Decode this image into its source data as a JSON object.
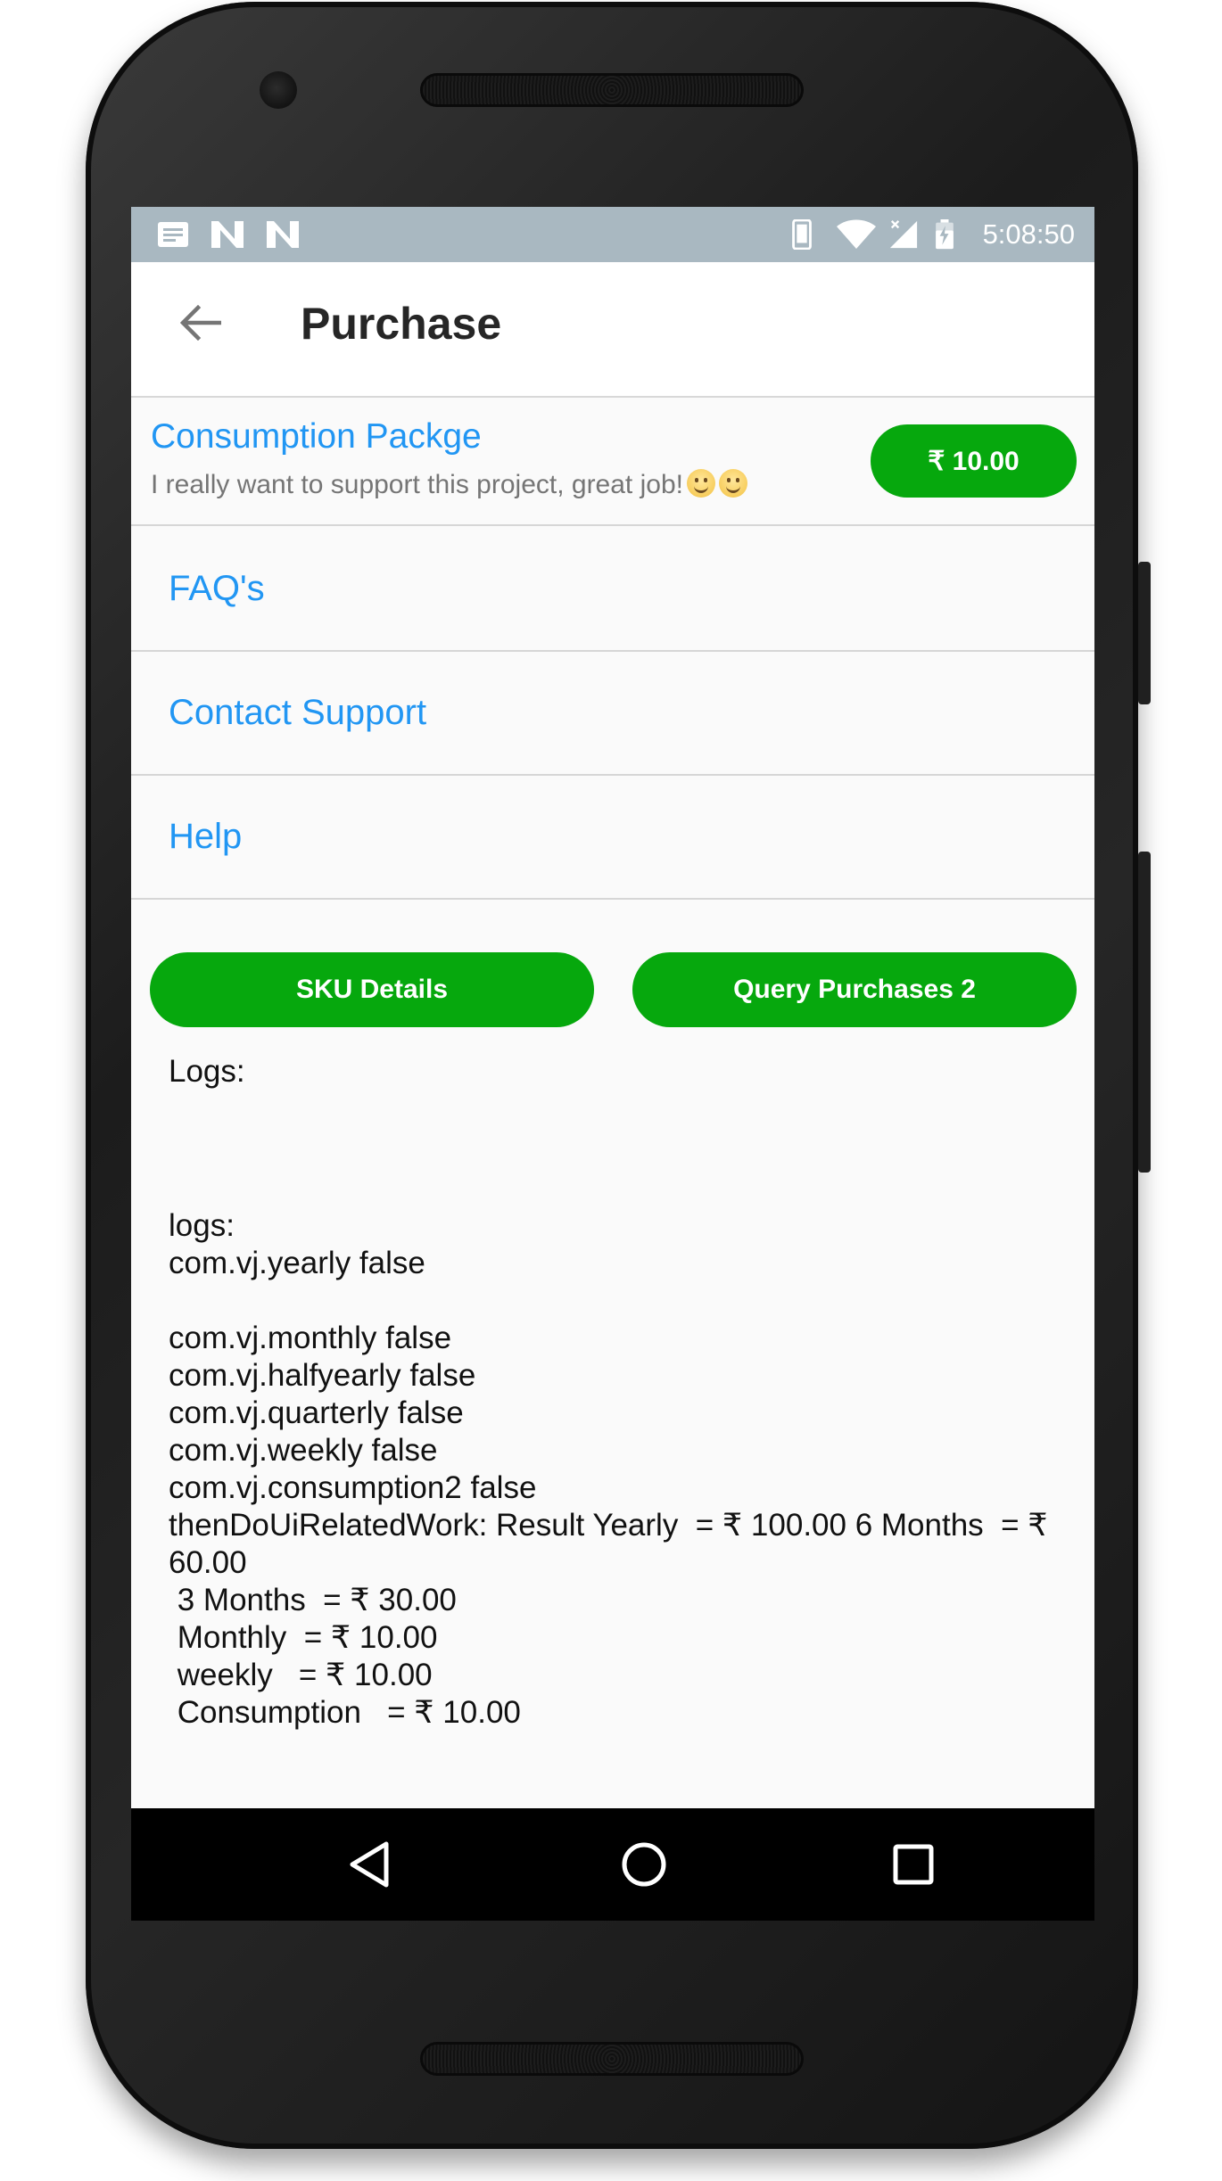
{
  "status_bar": {
    "time": "5:08:50",
    "icons": [
      "notification-icon",
      "n-icon",
      "n-icon",
      "phone-icon",
      "wifi-icon",
      "signal-icon",
      "battery-icon"
    ]
  },
  "app_bar": {
    "title": "Purchase",
    "back_icon": "arrow-back-icon"
  },
  "package": {
    "title": "Consumption Packge",
    "subtitle": "I really want to support this project, great job!",
    "price": "₹ 10.00"
  },
  "menu": {
    "items": [
      {
        "label": "FAQ's"
      },
      {
        "label": "Contact Support"
      },
      {
        "label": "Help"
      }
    ]
  },
  "actions": {
    "sku_details": "SKU Details",
    "query_purchases": "Query Purchases 2"
  },
  "logs": {
    "label": "Logs:",
    "body": "logs:\ncom.vj.yearly false\n\ncom.vj.monthly false\ncom.vj.halfyearly false\ncom.vj.quarterly false\ncom.vj.weekly false\ncom.vj.consumption2 false\nthenDoUiRelatedWork: Result Yearly  = ₹ 100.00 6 Months  = ₹ 60.00\n 3 Months  = ₹ 30.00\n Monthly  = ₹ 10.00\n weekly   = ₹ 10.00\n Consumption   = ₹ 10.00"
  },
  "colors": {
    "accent_green": "#06a80d",
    "link_blue": "#2196f3",
    "status_bar": "#a9b8c1"
  }
}
